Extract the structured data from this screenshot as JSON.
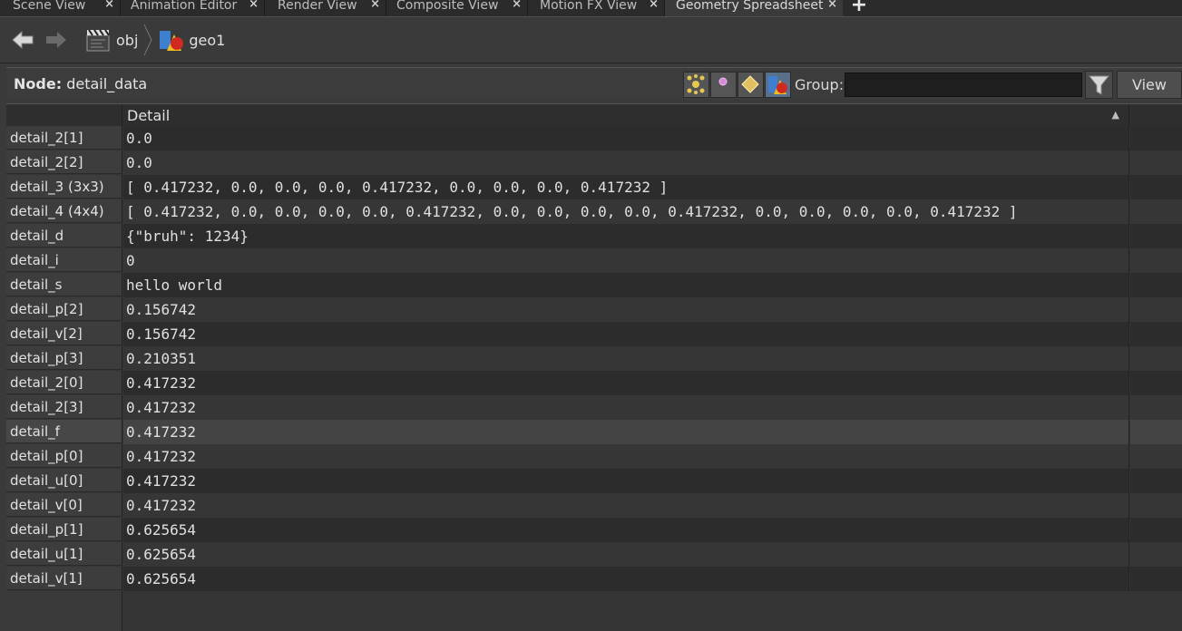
{
  "tabs": [
    {
      "label": "Scene View",
      "close": "×"
    },
    {
      "label": "Animation Editor",
      "close": "×"
    },
    {
      "label": "Render View",
      "close": "×"
    },
    {
      "label": "Composite View",
      "close": "×"
    },
    {
      "label": "Motion FX View",
      "close": "×"
    },
    {
      "label": "Geometry Spreadsheet",
      "close": "×",
      "active": true
    }
  ],
  "tab_add": "+",
  "path": {
    "crumbs": [
      "obj",
      "geo1"
    ]
  },
  "node": {
    "prefix": "Node:",
    "name": "detail_data"
  },
  "group": {
    "label": "Group:",
    "value": ""
  },
  "view_button": "View",
  "table": {
    "column_header": "Detail",
    "sort_indicator": "▲",
    "rows": [
      {
        "label": "detail_2[1]",
        "value": "0.0"
      },
      {
        "label": "detail_2[2]",
        "value": "0.0"
      },
      {
        "label": "detail_3 (3x3)",
        "value": "[ 0.417232, 0.0, 0.0, 0.0, 0.417232, 0.0, 0.0, 0.0, 0.417232 ]"
      },
      {
        "label": "detail_4 (4x4)",
        "value": "[ 0.417232, 0.0, 0.0, 0.0, 0.0, 0.417232, 0.0, 0.0, 0.0, 0.0, 0.417232, 0.0, 0.0, 0.0, 0.0, 0.417232 ]"
      },
      {
        "label": "detail_d",
        "value": "{\"bruh\": 1234}"
      },
      {
        "label": "detail_i",
        "value": "0"
      },
      {
        "label": "detail_s",
        "value": "hello world"
      },
      {
        "label": "detail_p[2]",
        "value": "0.156742"
      },
      {
        "label": "detail_v[2]",
        "value": "0.156742"
      },
      {
        "label": "detail_p[3]",
        "value": "0.210351"
      },
      {
        "label": "detail_2[0]",
        "value": "0.417232"
      },
      {
        "label": "detail_2[3]",
        "value": "0.417232"
      },
      {
        "label": "detail_f",
        "value": "0.417232",
        "highlighted": true
      },
      {
        "label": "detail_p[0]",
        "value": "0.417232"
      },
      {
        "label": "detail_u[0]",
        "value": "0.417232"
      },
      {
        "label": "detail_v[0]",
        "value": "0.417232"
      },
      {
        "label": "detail_p[1]",
        "value": "0.625654"
      },
      {
        "label": "detail_u[1]",
        "value": "0.625654"
      },
      {
        "label": "detail_v[1]",
        "value": "0.625654"
      }
    ]
  },
  "colors": {
    "accent_active_button": "#5a6f8a"
  }
}
